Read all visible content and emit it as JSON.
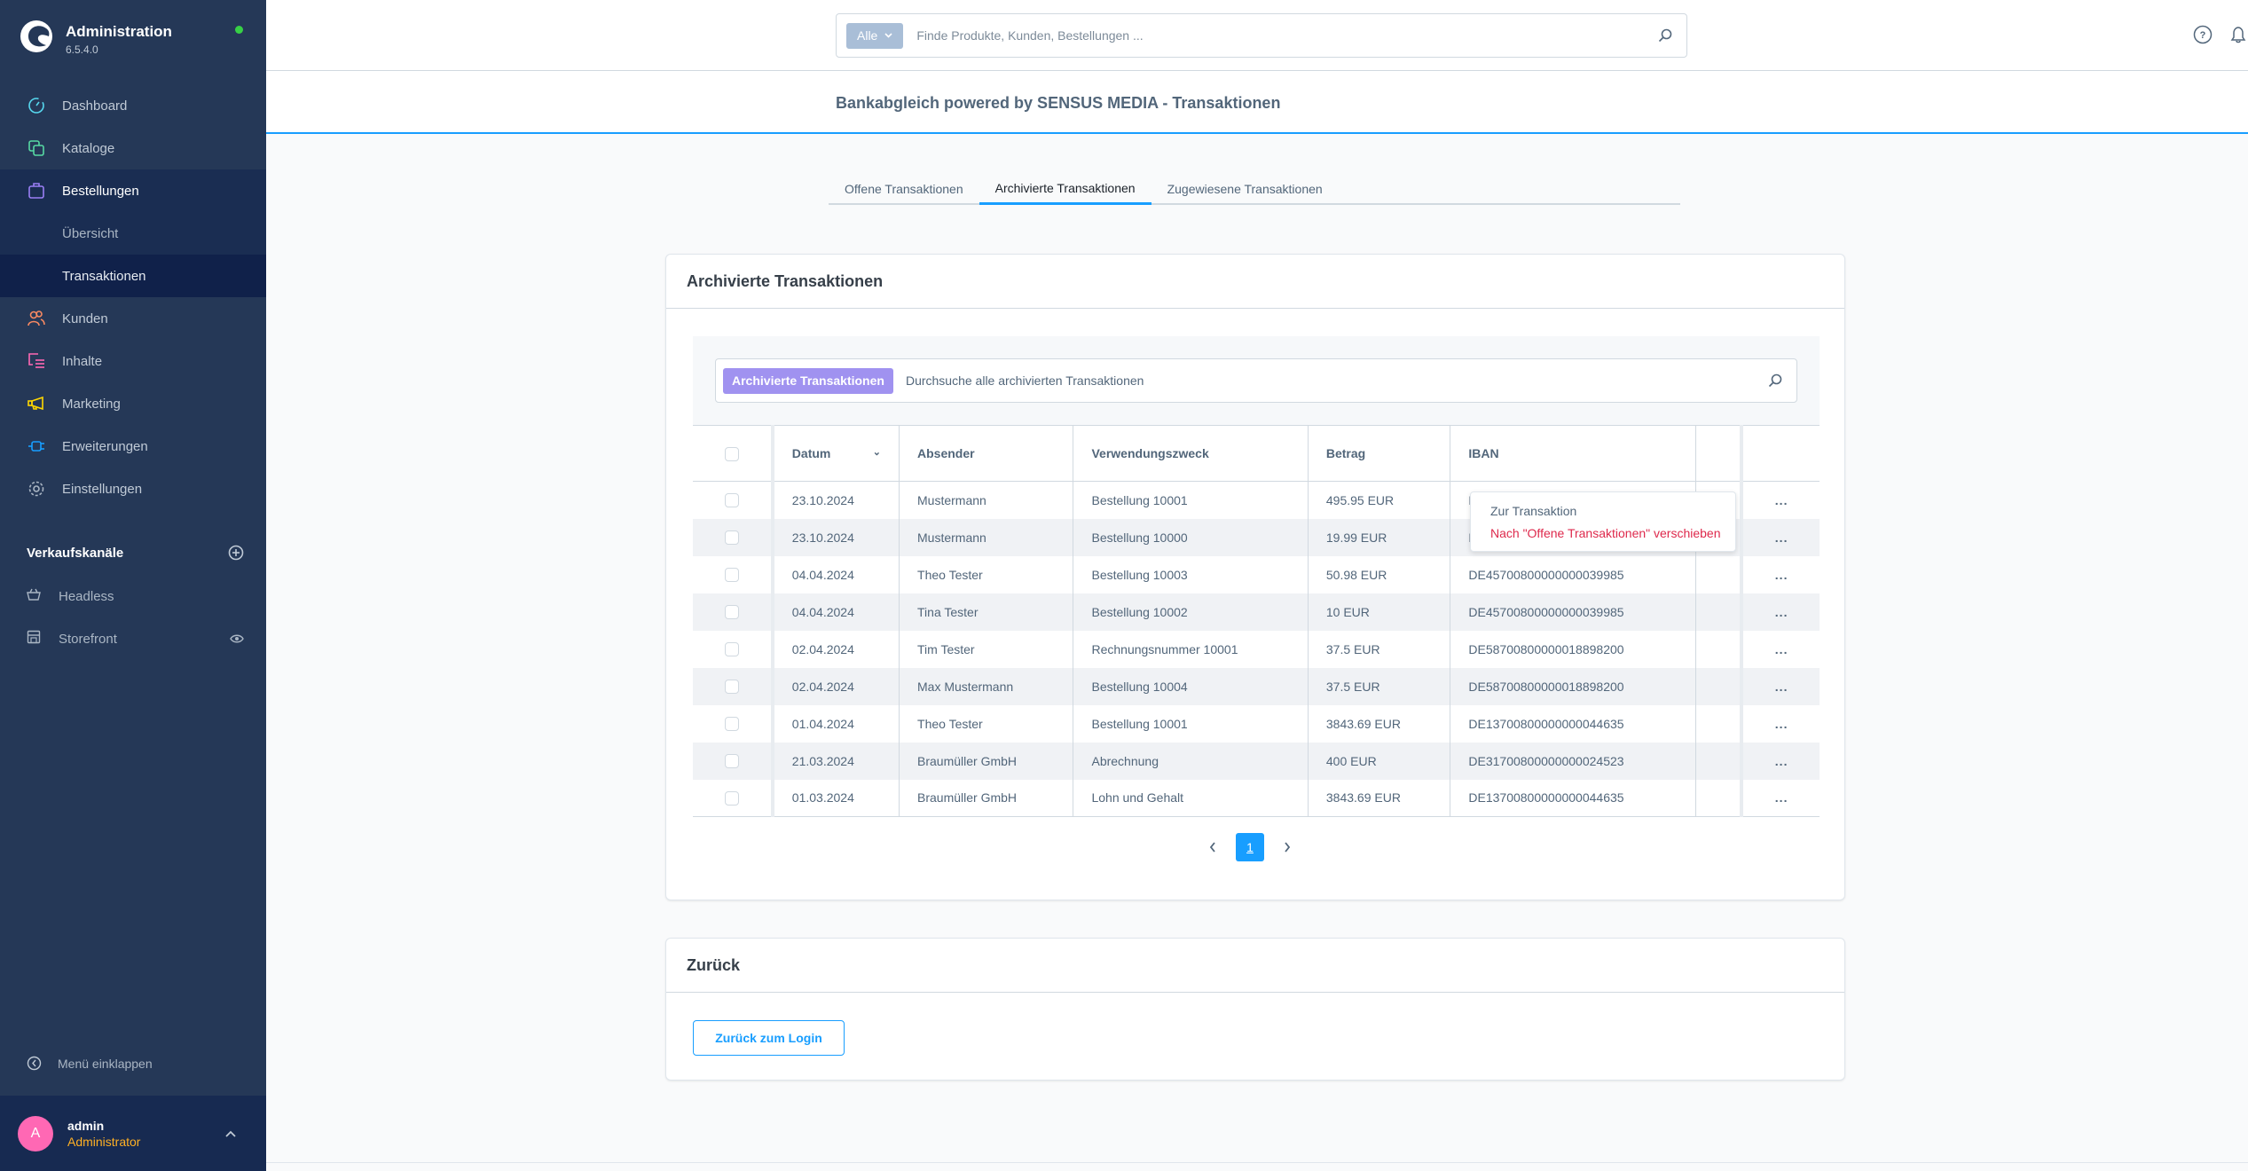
{
  "sidebar": {
    "brand_title": "Administration",
    "version": "6.5.4.0",
    "status_color": "#37d046",
    "nav": [
      {
        "label": "Dashboard",
        "icon": "gauge-icon",
        "color": "#57d9f0"
      },
      {
        "label": "Kataloge",
        "icon": "catalog-icon",
        "color": "#57d9a3"
      },
      {
        "label": "Bestellungen",
        "icon": "shopping-bag-icon",
        "color": "#9a7ff5"
      },
      {
        "label": "Übersicht"
      },
      {
        "label": "Transaktionen"
      },
      {
        "label": "Kunden",
        "icon": "users-icon",
        "color": "#f88962"
      },
      {
        "label": "Inhalte",
        "icon": "content-icon",
        "color": "#ff68b4"
      },
      {
        "label": "Marketing",
        "icon": "megaphone-icon",
        "color": "#ffd700"
      },
      {
        "label": "Erweiterungen",
        "icon": "plug-icon",
        "color": "#189eff"
      },
      {
        "label": "Einstellungen",
        "icon": "gear-icon",
        "color": "#aab6c4"
      }
    ],
    "channels_title": "Verkaufskanäle",
    "channels": [
      {
        "label": "Headless",
        "icon": "basket-icon"
      },
      {
        "label": "Storefront",
        "icon": "storefront-icon"
      }
    ],
    "collapse_label": "Menü einklappen",
    "user": {
      "initial": "A",
      "name": "admin",
      "role": "Administrator"
    }
  },
  "topbar": {
    "search_type": "Alle",
    "search_placeholder": "Finde Produkte, Kunden, Bestellungen ..."
  },
  "page": {
    "title": "Bankabgleich powered by SENSUS MEDIA - Transaktionen",
    "tabs": [
      {
        "label": "Offene Transaktionen",
        "active": false
      },
      {
        "label": "Archivierte Transaktionen",
        "active": true
      },
      {
        "label": "Zugewiesene Transaktionen",
        "active": false
      }
    ]
  },
  "card": {
    "title": "Archivierte Transaktionen",
    "search_badge": "Archivierte Transaktionen",
    "search_placeholder": "Durchsuche alle archivierten Transaktionen",
    "columns": [
      "Datum",
      "Absender",
      "Verwendungszweck",
      "Betrag",
      "IBAN"
    ],
    "rows": [
      {
        "datum": "23.10.2024",
        "absender": "Mustermann",
        "zweck": "Bestellung 10001",
        "betrag": "495.95 EUR",
        "iban": "DE45700800000000039985"
      },
      {
        "datum": "23.10.2024",
        "absender": "Mustermann",
        "zweck": "Bestellung 10000",
        "betrag": "19.99 EUR",
        "iban": "DE45700800000000039985"
      },
      {
        "datum": "04.04.2024",
        "absender": "Theo Tester",
        "zweck": "Bestellung 10003",
        "betrag": "50.98 EUR",
        "iban": "DE45700800000000039985"
      },
      {
        "datum": "04.04.2024",
        "absender": "Tina Tester",
        "zweck": "Bestellung 10002",
        "betrag": "10 EUR",
        "iban": "DE45700800000000039985"
      },
      {
        "datum": "02.04.2024",
        "absender": "Tim Tester",
        "zweck": "Rechnungsnummer 10001",
        "betrag": "37.5 EUR",
        "iban": "DE58700800000018898200"
      },
      {
        "datum": "02.04.2024",
        "absender": "Max Mustermann",
        "zweck": "Bestellung 10004",
        "betrag": "37.5 EUR",
        "iban": "DE58700800000018898200"
      },
      {
        "datum": "01.04.2024",
        "absender": "Theo Tester",
        "zweck": "Bestellung 10001",
        "betrag": "3843.69 EUR",
        "iban": "DE13700800000000044635"
      },
      {
        "datum": "21.03.2024",
        "absender": "Braumüller GmbH",
        "zweck": "Abrechnung",
        "betrag": "400 EUR",
        "iban": "DE31700800000000024523"
      },
      {
        "datum": "01.03.2024",
        "absender": "Braumüller GmbH",
        "zweck": "Lohn und Gehalt",
        "betrag": "3843.69 EUR",
        "iban": "DE13700800000000044635"
      }
    ],
    "row_actions_label": "...",
    "context_menu": [
      "Zur Transaktion",
      "Nach \"Offene Transaktionen\" verschieben"
    ],
    "current_page": "1"
  },
  "back_card": {
    "title": "Zurück",
    "button_label": "Zurück zum Login"
  },
  "colors": {
    "accent": "#189eff",
    "sidebar_bg": "#253857",
    "badge_purple": "#a092f0",
    "danger": "#de294c",
    "role": "#ffb024",
    "avatar": "#ff68b4"
  }
}
